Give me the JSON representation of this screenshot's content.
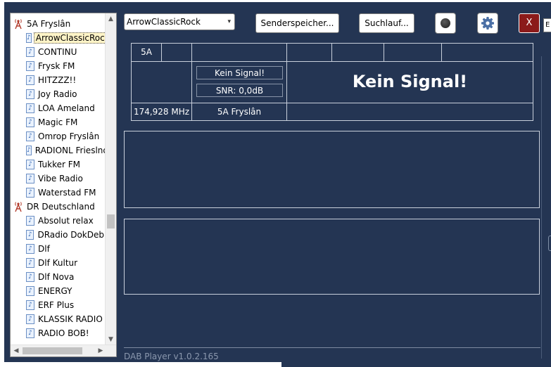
{
  "tree": {
    "groups": [
      {
        "label": "5A Fryslân",
        "children": [
          "ArrowClassicRock",
          "CONTINU",
          "Frysk FM",
          "HITZZZ!!",
          "Joy Radio",
          "LOA Ameland",
          "Magic FM",
          "Omrop Fryslân",
          "RADIONL Frieslnd",
          "Tukker FM",
          "Vibe Radio",
          "Waterstad FM"
        ]
      },
      {
        "label": "DR Deutschland",
        "children": [
          "Absolut relax",
          "DRadio DokDeb",
          "Dlf",
          "Dlf Kultur",
          "Dlf Nova",
          "ENERGY",
          "ERF Plus",
          "KLASSIK RADIO",
          "RADIO BOB!"
        ]
      }
    ],
    "selected": "ArrowClassicRock"
  },
  "toolbar": {
    "station_select": "ArrowClassicRock",
    "presets_label": "Senderspeicher...",
    "scan_label": "Suchlauf...",
    "close_label": "X",
    "edge_label": "E"
  },
  "info": {
    "channel": "5A",
    "signal_status": "Kein Signal!",
    "snr": "SNR: 0,0dB",
    "big_status": "Kein Signal!",
    "frequency": "174,928 MHz",
    "ensemble": "5A Fryslân"
  },
  "footer": {
    "version": "DAB Player v1.0.2.165"
  }
}
